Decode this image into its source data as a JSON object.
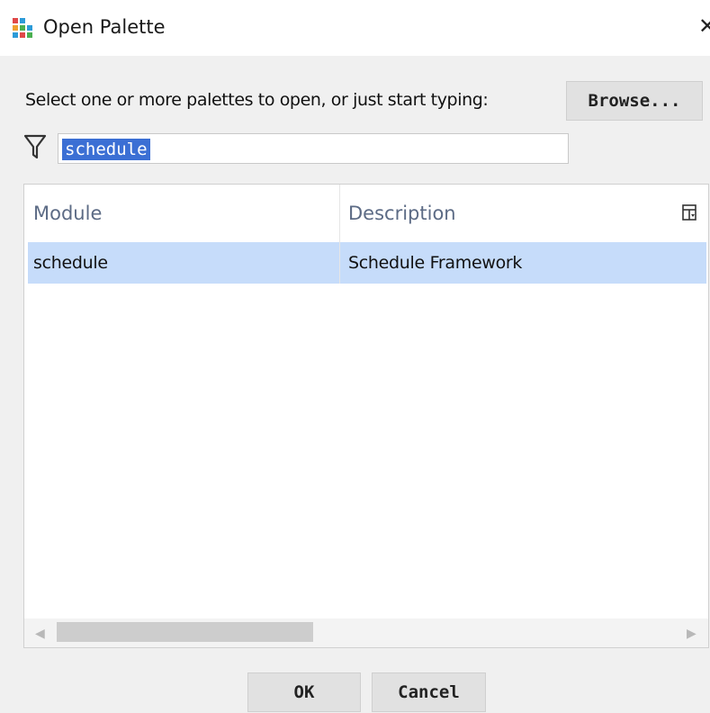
{
  "window": {
    "title": "Open Palette",
    "close_glyph": "✕"
  },
  "prompt": {
    "text": "Select one or more palettes to open, or just start typing:",
    "browse_label": "Browse..."
  },
  "filter": {
    "value": "schedule"
  },
  "table": {
    "columns": [
      "Module",
      "Description"
    ],
    "rows": [
      {
        "module": "schedule",
        "description": "Schedule Framework"
      }
    ],
    "selected_row": 0
  },
  "footer": {
    "ok_label": "OK",
    "cancel_label": "Cancel"
  },
  "colors": {
    "selection": "#c6dcfa",
    "text_highlight": "#3b6fd4",
    "header_text": "#5c6b85"
  },
  "icons": {
    "app": "palette-app-icon",
    "filter": "funnel-icon",
    "column_chooser": "column-chooser-icon",
    "scroll_left": "chevron-left-icon",
    "scroll_right": "chevron-right-icon"
  }
}
